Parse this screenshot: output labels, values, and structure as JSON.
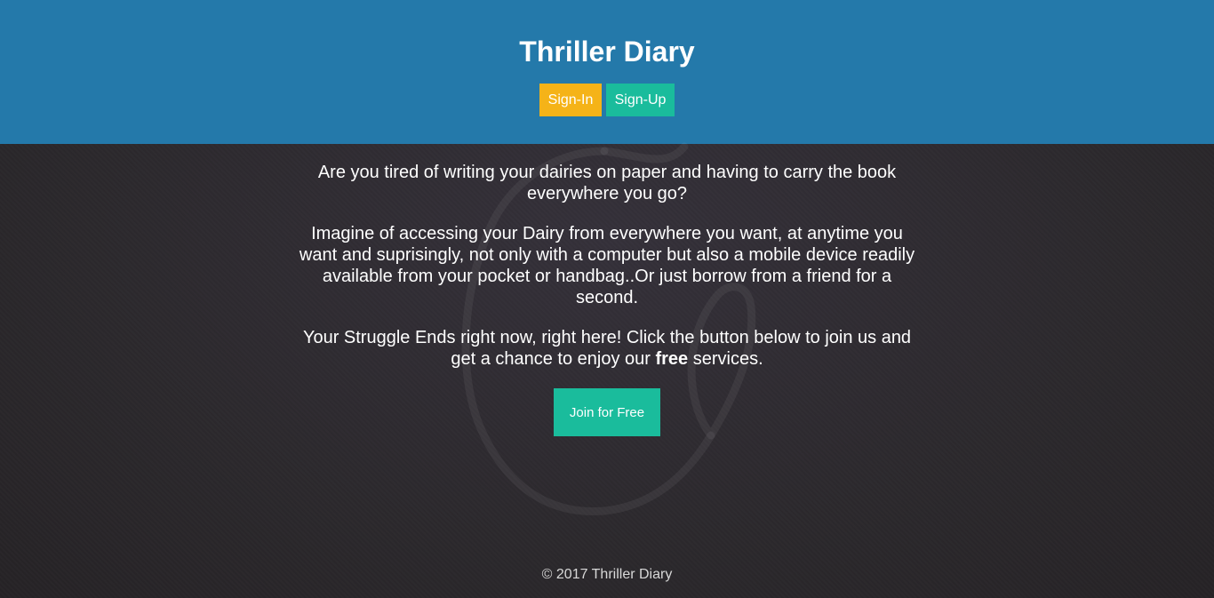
{
  "header": {
    "title": "Thriller Diary",
    "signin_label": "Sign-In",
    "signup_label": "Sign-Up"
  },
  "main": {
    "paragraph1": "Are you tired of writing your dairies on paper and having to carry the book everywhere you go?",
    "paragraph2": "Imagine of accessing your Dairy from everywhere you want, at anytime you want and suprisingly, not only with a computer but also a mobile device readily available from your pocket or handbag..Or just borrow from a friend for a second.",
    "paragraph3_before": "Your Struggle Ends right now, right here! Click the button below to join us and get a chance to enjoy our ",
    "paragraph3_bold": "free",
    "paragraph3_after": " services.",
    "join_label": "Join for Free"
  },
  "footer": {
    "copyright": "© 2017 Thriller Diary"
  },
  "colors": {
    "header_bg": "#2479aa",
    "signin_bg": "#f5b318",
    "signup_bg": "#1abc9c",
    "join_bg": "#1abc9c",
    "page_bg": "#2d2a2e"
  }
}
